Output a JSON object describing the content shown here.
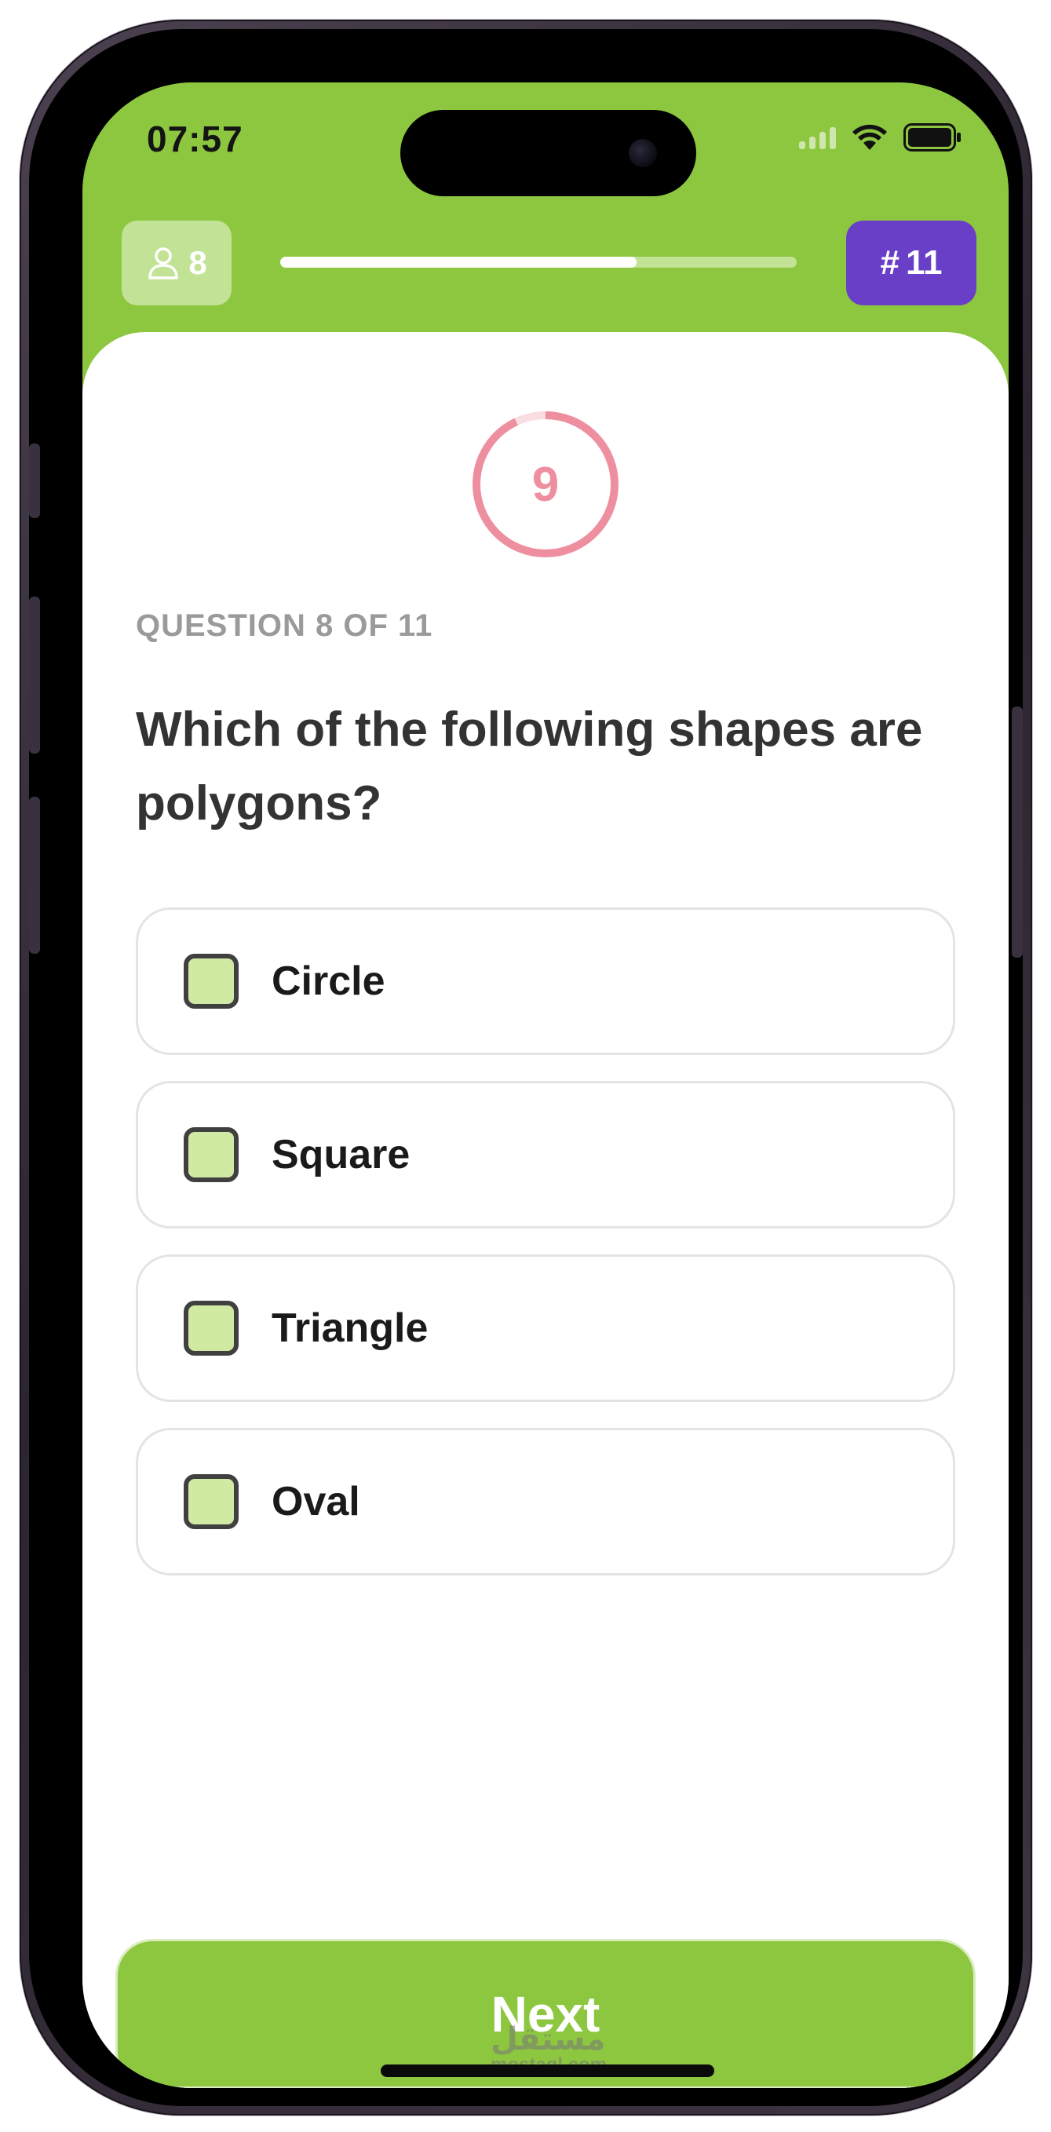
{
  "status_bar": {
    "time": "07:57"
  },
  "header": {
    "players_count": "8",
    "progress_fraction": 0.69,
    "question_total_label": "11",
    "colors": {
      "primary": "#8dc63f",
      "accent": "#6a3fc7"
    }
  },
  "timer": {
    "value": "9",
    "remaining_fraction": 0.93,
    "color": "#ee8fa0"
  },
  "question": {
    "meta": "QUESTION 8 OF 11",
    "text": "Which of the following shapes are polygons?"
  },
  "options": [
    {
      "label": "Circle",
      "checked": false
    },
    {
      "label": "Square",
      "checked": false
    },
    {
      "label": "Triangle",
      "checked": false
    },
    {
      "label": "Oval",
      "checked": false
    }
  ],
  "actions": {
    "next_label": "Next"
  },
  "watermark": {
    "logo": "مستقل",
    "url": "mostaql.com"
  }
}
